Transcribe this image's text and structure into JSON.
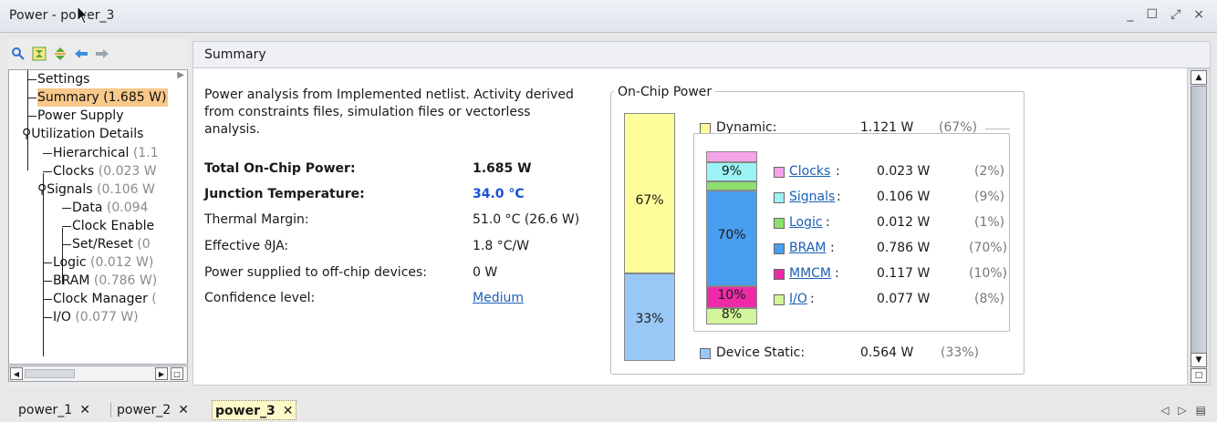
{
  "window": {
    "title": "Power - power_3",
    "controls": [
      "_",
      "☐",
      "⤢",
      "×"
    ]
  },
  "left": {
    "toolbar": [
      "search-icon",
      "collapse-all-icon",
      "expand-all-icon",
      "back-arrow-icon",
      "forward-arrow-icon"
    ],
    "tree": {
      "settings": "Settings",
      "summary": "Summary (1.685 W)",
      "power_supply": "Power Supply",
      "utilization": "Utilization Details",
      "hierarchical": "Hierarchical",
      "hierarchical_dim": " (1.1",
      "clocks": "Clocks",
      "clocks_dim": " (0.023 W",
      "signals": "Signals",
      "signals_dim": " (0.106 W",
      "data": "Data",
      "data_dim": " (0.094",
      "clock_enable": "Clock Enable",
      "set_reset": "Set/Reset",
      "set_reset_dim": " (0",
      "logic": "Logic",
      "logic_dim": " (0.012 W)",
      "bram": "BRAM",
      "bram_dim": " (0.786 W)",
      "clock_manager": "Clock Manager",
      "clock_manager_dim": " (",
      "io": "I/O",
      "io_dim": " (0.077 W)"
    }
  },
  "main": {
    "header": "Summary",
    "description": "Power analysis from Implemented netlist. Activity derived from constraints files, simulation files or vectorless analysis.",
    "rows": {
      "total_label": "Total On-Chip Power:",
      "total_value": "1.685 W",
      "junction_label": "Junction Temperature:",
      "junction_value": "34.0 °C",
      "thermal_label": "Thermal Margin:",
      "thermal_value": "51.0 °C (26.6 W)",
      "theta_label": "Effective ϑJA:",
      "theta_value": "1.8 °C/W",
      "offchip_label": "Power supplied to off-chip devices:",
      "offchip_value": "0 W",
      "confidence_label": "Confidence level:",
      "confidence_value": "Medium"
    }
  },
  "onchip": {
    "title": "On-Chip Power",
    "dynamic": {
      "label": "Dynamic:",
      "value": "1.121 W",
      "pct": "(67%)",
      "bar_pct": "67%",
      "color": "#fdfd9a"
    },
    "static": {
      "label": "Device Static:",
      "value": "0.564 W",
      "pct": "(33%)",
      "bar_pct": "33%",
      "color": "#9ac8f6"
    },
    "breakdown": {
      "clocks": {
        "label": "Clocks",
        "value": "0.023 W",
        "pct": "(2%)",
        "color": "#f5a3e8"
      },
      "signals": {
        "label": "Signals",
        "value": "0.106 W",
        "pct": "(9%)",
        "color": "#9cf3f3",
        "bar_pct": "9%"
      },
      "logic": {
        "label": "Logic",
        "value": "0.012 W",
        "pct": "(1%)",
        "color": "#8ee06e"
      },
      "bram": {
        "label": "BRAM",
        "value": "0.786 W",
        "pct": "(70%)",
        "color": "#4a9ef0",
        "bar_pct": "70%"
      },
      "mmcm": {
        "label": "MMCM",
        "value": "0.117 W",
        "pct": "(10%)",
        "color": "#ee2aa6",
        "bar_pct": "10%"
      },
      "io": {
        "label": "I/O",
        "value": "0.077 W",
        "pct": "(8%)",
        "color": "#d2f59b",
        "bar_pct": "8%"
      }
    }
  },
  "tabs": [
    {
      "label": "power_1"
    },
    {
      "label": "power_2"
    },
    {
      "label": "power_3"
    }
  ]
}
